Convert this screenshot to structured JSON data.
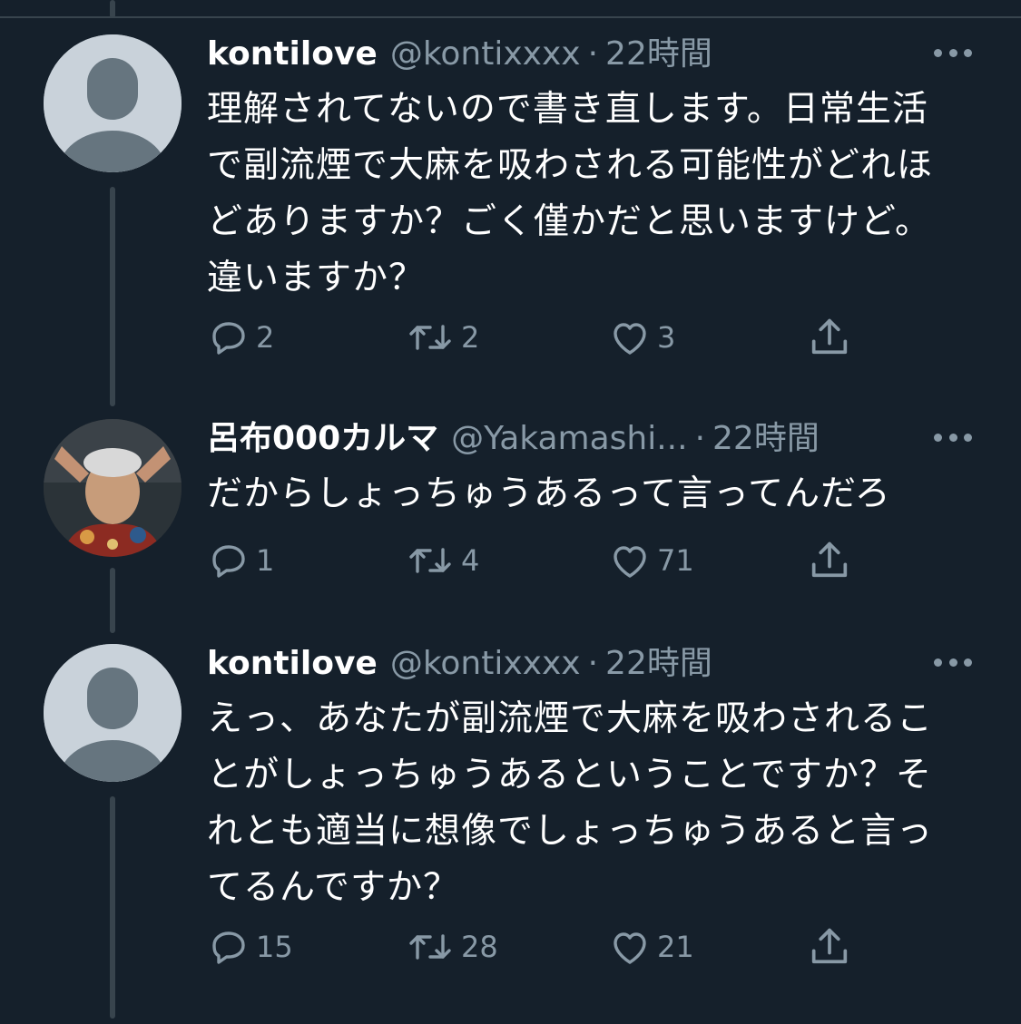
{
  "tweets": [
    {
      "display_name": "kontilove",
      "handle": "@kontixxxx",
      "separator": "·",
      "time": "22時間",
      "lines": [
        "理解されてないので書き直します。日常生活",
        "で副流煙で大麻を吸わされる可能性がどれほ",
        "どありますか？ごく僅かだと思いますけど。",
        "違いますか？"
      ],
      "replies": "2",
      "retweets": "2",
      "likes": "3",
      "avatar_icon": "default-profile-icon"
    },
    {
      "display_name": "呂布000カルマ",
      "handle": "@Yakamashi...",
      "separator": "·",
      "time": "22時間",
      "lines": [
        "だからしょっちゅうあるって言ってんだろ"
      ],
      "replies": "1",
      "retweets": "4",
      "likes": "71",
      "avatar_icon": "profile-photo"
    },
    {
      "display_name": "kontilove",
      "handle": "@kontixxxx",
      "separator": "·",
      "time": "22時間",
      "lines": [
        "えっ、あなたが副流煙で大麻を吸わされるこ",
        "とがしょっちゅうあるということですか？そ",
        "れとも適当に想像でしょっちゅうあると言っ",
        "てるんですか？"
      ],
      "replies": "15",
      "retweets": "28",
      "likes": "21",
      "avatar_icon": "default-profile-icon"
    }
  ],
  "colors": {
    "background": "#15202b",
    "text": "#ffffff",
    "secondary": "#8899a6",
    "thread_line": "#38444d",
    "avatar_bg": "#c9d2da",
    "avatar_fg": "#66757f"
  }
}
